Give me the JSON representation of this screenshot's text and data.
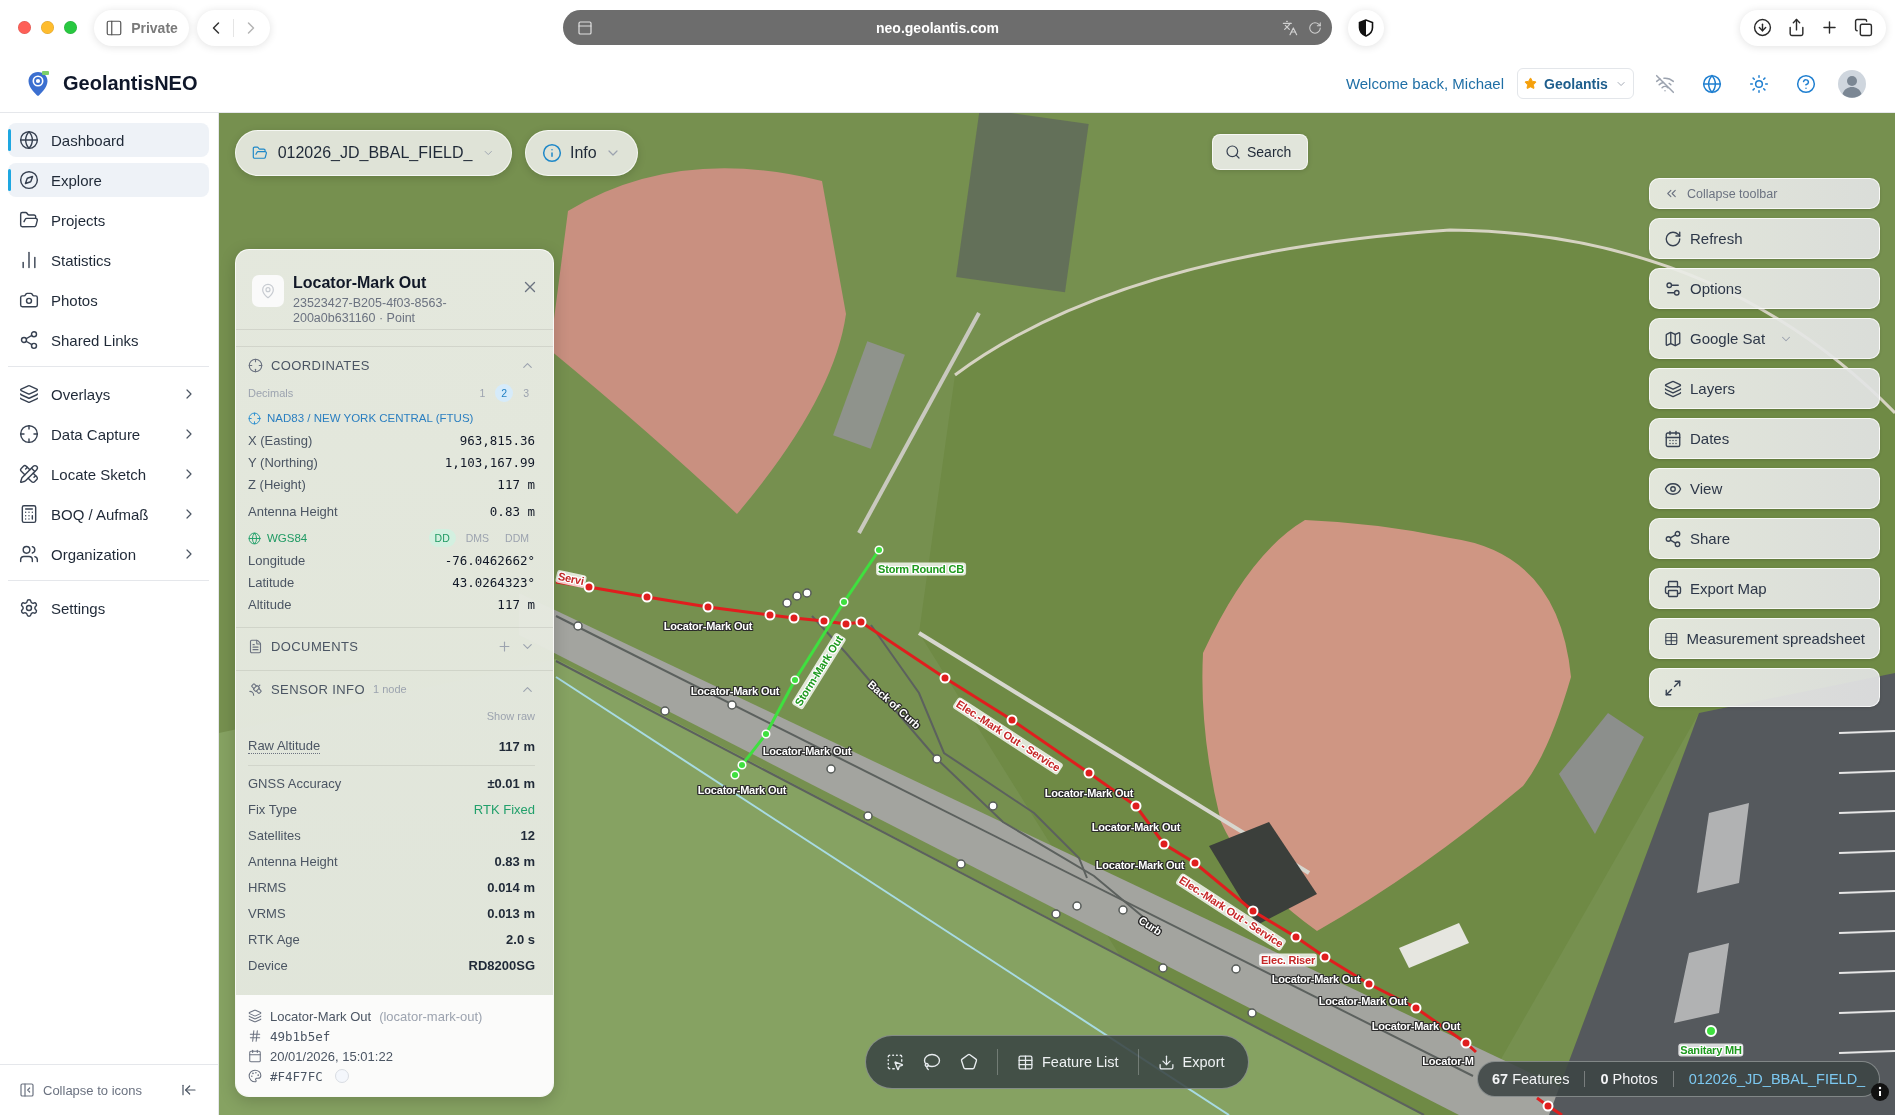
{
  "browser": {
    "tab_mode": "Private",
    "url": "neo.geolantis.com",
    "back_disabled": false,
    "forward_disabled": true
  },
  "header": {
    "app_name": "GeolantisNEO",
    "welcome": "Welcome back, Michael",
    "workspace": "Geolantis"
  },
  "sidebar": {
    "groups": [
      {
        "items": [
          {
            "label": "Dashboard",
            "kind": "link",
            "selected": true
          },
          {
            "label": "Explore",
            "kind": "link",
            "selected": true
          },
          {
            "label": "Projects",
            "kind": "link",
            "selected": false
          },
          {
            "label": "Statistics",
            "kind": "link",
            "selected": false
          },
          {
            "label": "Photos",
            "kind": "link",
            "selected": false
          },
          {
            "label": "Shared Links",
            "kind": "link",
            "selected": false
          }
        ]
      },
      {
        "items": [
          {
            "label": "Overlays",
            "kind": "menu",
            "selected": false
          },
          {
            "label": "Data Capture",
            "kind": "menu",
            "selected": false
          },
          {
            "label": "Locate Sketch",
            "kind": "menu",
            "selected": false
          },
          {
            "label": "BOQ / Aufmaß",
            "kind": "menu",
            "selected": false
          },
          {
            "label": "Organization",
            "kind": "menu",
            "selected": false
          }
        ]
      },
      {
        "items": [
          {
            "label": "Settings",
            "kind": "link",
            "selected": false
          }
        ]
      }
    ],
    "collapse_label": "Collapse to icons"
  },
  "map": {
    "project": "012026_JD_BBAL_FIELD_",
    "info": "Info",
    "search": "Search",
    "labels": [
      {
        "text": "Storm Round CB",
        "color": "#1f9a1f"
      },
      {
        "text": "Servi",
        "color": "#c62828"
      },
      {
        "text": "Locator-Mark Out",
        "color": "#ffffff"
      },
      {
        "text": "Storm-Mark Out",
        "color": "#1f9a1f"
      },
      {
        "text": "Locator-Mark Out",
        "color": "#ffffff"
      },
      {
        "text": "Back of Curb",
        "color": "#ffffff"
      },
      {
        "text": "Elec.-Mark Out - Service",
        "color": "#c62828"
      },
      {
        "text": "Locator-Mark Out",
        "color": "#ffffff"
      },
      {
        "text": "Locator-Mark Out",
        "color": "#ffffff"
      },
      {
        "text": "Locator-Mark Out",
        "color": "#ffffff"
      },
      {
        "text": "Locator-Mark Out",
        "color": "#ffffff"
      },
      {
        "text": "Locator-Mark Out",
        "color": "#ffffff"
      },
      {
        "text": "Elec.-Mark Out - Service",
        "color": "#c62828"
      },
      {
        "text": "Curb",
        "color": "#ffffff"
      },
      {
        "text": "Elec. Riser",
        "color": "#c62828"
      },
      {
        "text": "Locator-Mark Out",
        "color": "#ffffff"
      },
      {
        "text": "Locator-Mark Out",
        "color": "#ffffff"
      },
      {
        "text": "Locator-Mark Out",
        "color": "#ffffff"
      },
      {
        "text": "Sanitary MH",
        "color": "#1f9a1f"
      },
      {
        "text": "Locator-M",
        "color": "#ffffff"
      }
    ],
    "toolbar": {
      "collapse": "Collapse toolbar",
      "buttons": [
        {
          "kind": "plain",
          "label": "Refresh"
        },
        {
          "kind": "plain",
          "label": "Options"
        },
        {
          "kind": "dropdown",
          "label": "Google Sat"
        },
        {
          "kind": "plain",
          "label": "Layers"
        },
        {
          "kind": "plain",
          "label": "Dates"
        },
        {
          "kind": "plain",
          "label": "View"
        },
        {
          "kind": "plain",
          "label": "Share"
        },
        {
          "kind": "plain",
          "label": "Export Map"
        },
        {
          "kind": "plain",
          "label": "Measurement spreadsheet"
        },
        {
          "kind": "icon"
        }
      ]
    },
    "actions": {
      "feature_list": "Feature List",
      "export": "Export"
    },
    "status": {
      "features": "**67** Features",
      "photos": "**0** Photos",
      "project_link": "012026_JD_BBAL_FIELD_"
    }
  },
  "feature_panel": {
    "title": "Locator-Mark Out",
    "subtitle": "23523427-B205-4f03-8563-200a0b631160 · Point",
    "coordinates": {
      "title": "COORDINATES",
      "expanded": true,
      "decimals_label": "Decimals",
      "decimals": [
        {
          "label": "1",
          "selected": false
        },
        {
          "label": "2",
          "selected": true
        },
        {
          "label": "3",
          "selected": false
        }
      ],
      "projected": {
        "crs": "NAD83 / NEW YORK CENTRAL (FTUS)",
        "rows": [
          {
            "label": "X (Easting)",
            "value": "963,815.36"
          },
          {
            "label": "Y (Northing)",
            "value": "1,103,167.99"
          },
          {
            "label": "Z (Height)",
            "value": "117 m"
          }
        ]
      },
      "antenna": {
        "label": "Antenna Height",
        "value": "0.83 m"
      },
      "geographic": {
        "crs": "WGS84",
        "formats": [
          {
            "label": "DD",
            "selected": true
          },
          {
            "label": "DMS",
            "selected": false
          },
          {
            "label": "DDM",
            "selected": false
          }
        ],
        "rows": [
          {
            "label": "Longitude",
            "value": "-76.0462662°"
          },
          {
            "label": "Latitude",
            "value": "43.0264323°"
          },
          {
            "label": "Altitude",
            "value": "117 m"
          }
        ]
      }
    },
    "documents": {
      "title": "DOCUMENTS",
      "expanded": false
    },
    "sensor": {
      "title": "SENSOR INFO",
      "count": "1 node",
      "expanded": true,
      "show_raw": "Show raw",
      "raw": [
        {
          "label": "Raw Altitude",
          "value": "117 m"
        }
      ],
      "rows": [
        {
          "label": "GNSS Accuracy",
          "value": "±0.01 m",
          "kind": "value"
        },
        {
          "label": "Fix Type",
          "value": "RTK Fixed",
          "kind": "status"
        },
        {
          "label": "Satellites",
          "value": "12",
          "kind": "value"
        },
        {
          "label": "Antenna Height",
          "value": "0.83 m",
          "kind": "value"
        },
        {
          "label": "HRMS",
          "value": "0.014 m",
          "kind": "value"
        },
        {
          "label": "VRMS",
          "value": "0.013 m",
          "kind": "value"
        },
        {
          "label": "RTK Age",
          "value": "2.0 s",
          "kind": "value"
        },
        {
          "label": "Device",
          "value": "RD8200SG",
          "kind": "value"
        }
      ]
    },
    "footer": {
      "layer": "Locator-Mark Out",
      "layer_id": "(locator-mark-out)",
      "hash": "49b1b5ef",
      "timestamp": "20/01/2026, 15:01:22",
      "color_text": "#F4F7FC",
      "color": "#f4f7fc"
    }
  }
}
